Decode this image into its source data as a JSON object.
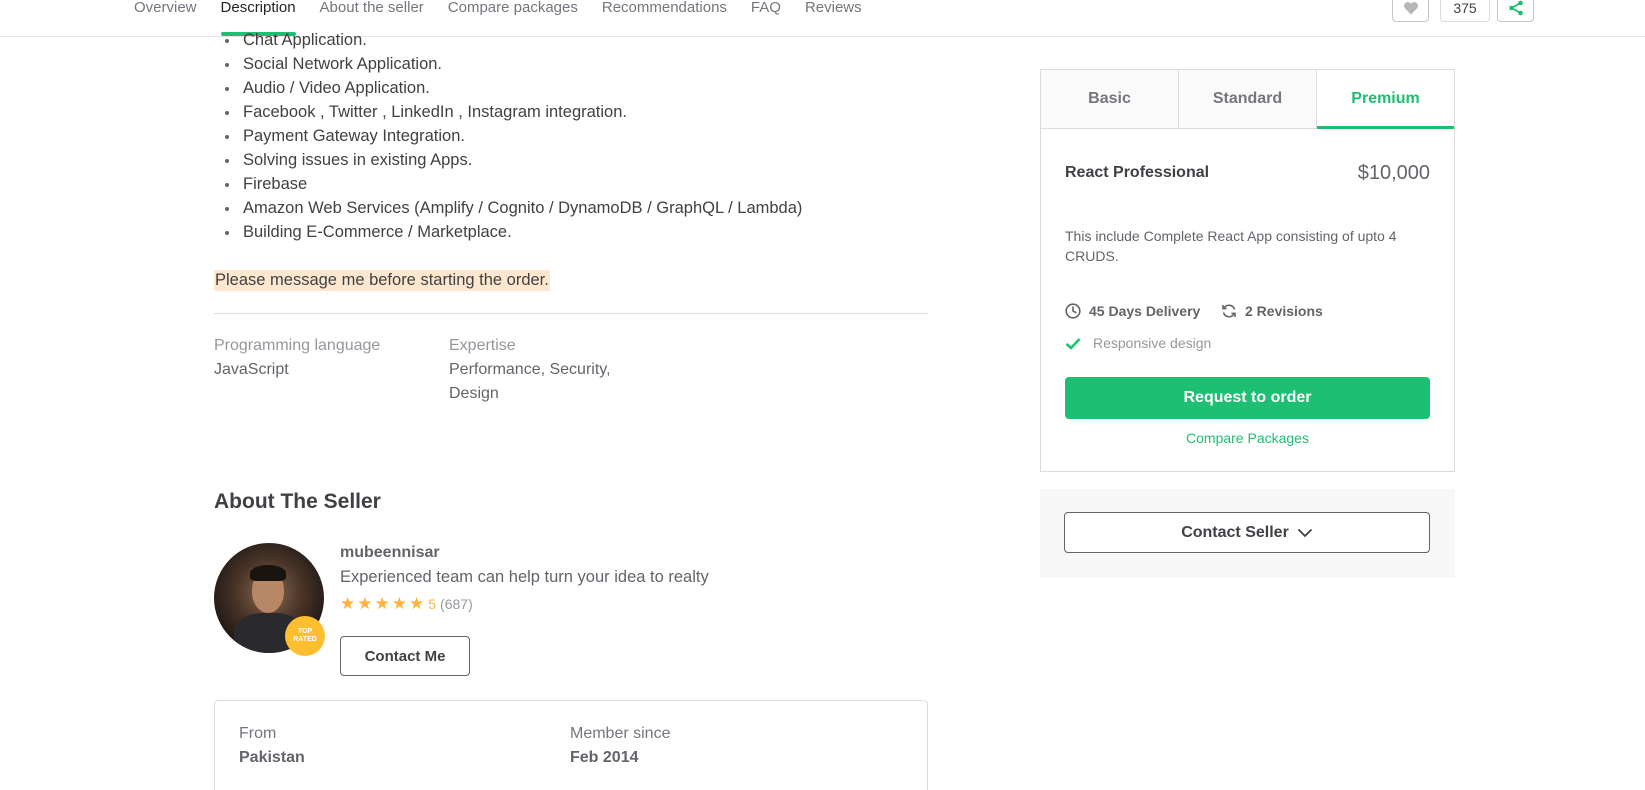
{
  "nav": {
    "links": [
      "Overview",
      "Description",
      "About the seller",
      "Compare packages",
      "Recommendations",
      "FAQ",
      "Reviews"
    ],
    "active": "Description",
    "favorite_count": "375",
    "accent_color": "#1dbf73"
  },
  "description": {
    "items": [
      "Chat Application.",
      "Social Network Application.",
      "Audio / Video Application.",
      "Facebook , Twitter , LinkedIn , Instagram integration.",
      "Payment Gateway Integration.",
      "Solving issues in existing Apps.",
      "Firebase",
      "Amazon Web Services (Amplify / Cognito / DynamoDB / GraphQL / Lambda)",
      "Building E-Commerce / Marketplace."
    ],
    "note": "Please message me before starting the order."
  },
  "metadata": {
    "language_label": "Programming language",
    "language_value": "JavaScript",
    "expertise_label": "Expertise",
    "expertise_line1": "Performance, Security,",
    "expertise_line2": "Design"
  },
  "about": {
    "title": "About The Seller",
    "badge_line1": "TOP",
    "badge_line2": "RATED",
    "seller_name": "mubeennisar",
    "tagline": "Experienced team can help turn your idea to realty",
    "rating": "5",
    "rating_count": "(687)",
    "stars": 5,
    "contact_label": "Contact Me",
    "from_label": "From",
    "from_value": "Pakistan",
    "member_label": "Member since",
    "member_value": "Feb 2014"
  },
  "package": {
    "tabs": [
      "Basic",
      "Standard",
      "Premium"
    ],
    "active_tab": "Premium",
    "name": "React Professional",
    "price": "$10,000",
    "description": "This include Complete React App consisting of upto 4 CRUDS.",
    "delivery": "45 Days Delivery",
    "revisions": "2 Revisions",
    "feature": "Responsive design",
    "order_label": "Request to order",
    "compare_label": "Compare Packages",
    "contact_seller_label": "Contact Seller"
  }
}
